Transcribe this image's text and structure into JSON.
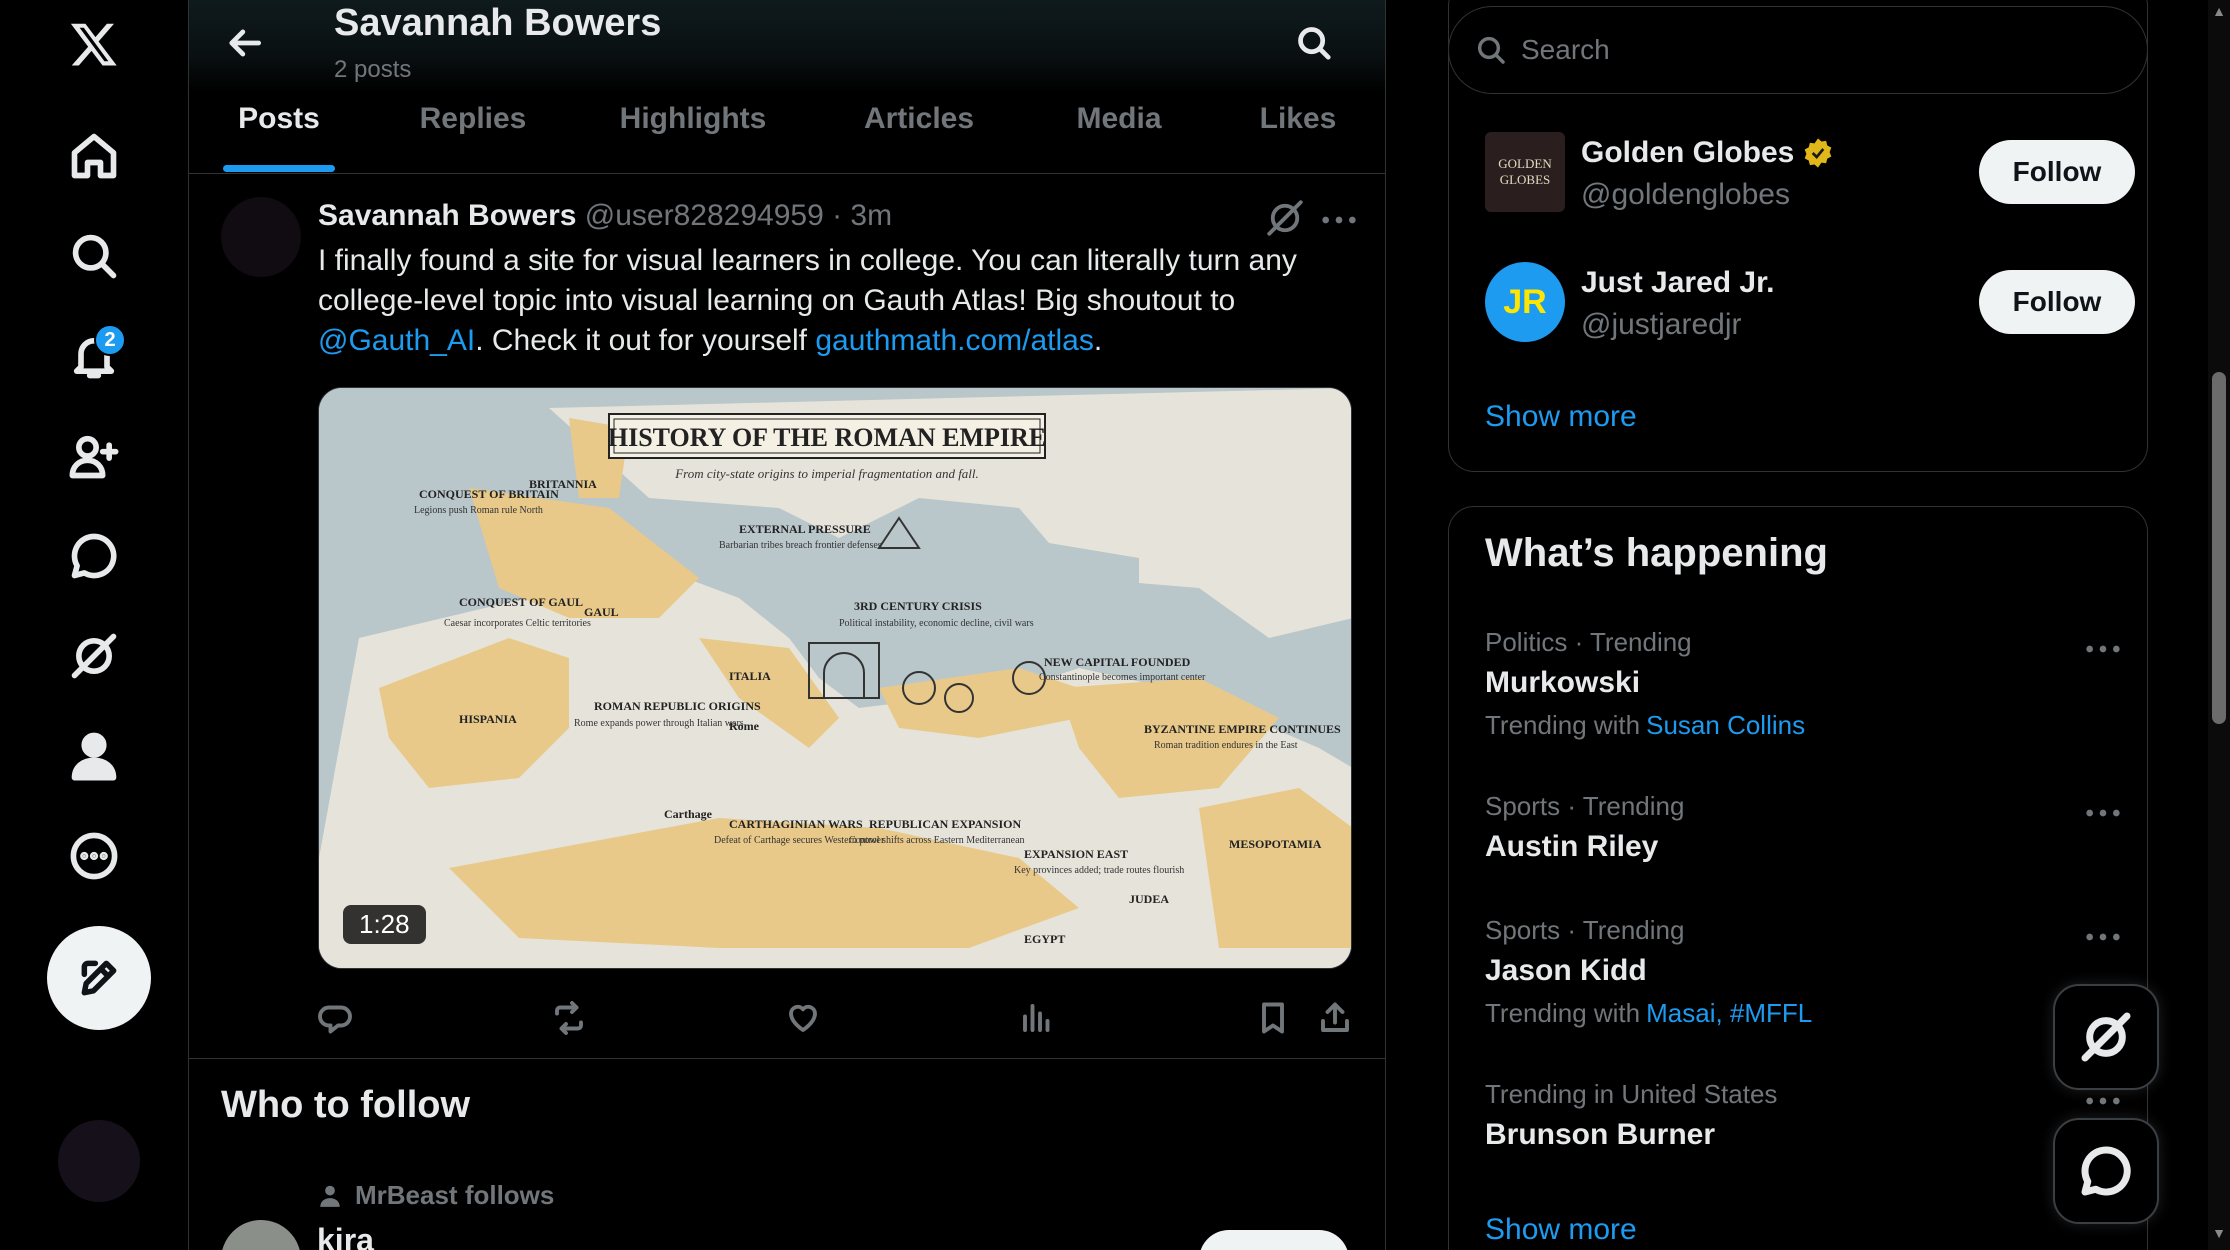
{
  "nav": {
    "notifications_badge": "2"
  },
  "header": {
    "title": "Savannah Bowers",
    "subtitle": "2 posts"
  },
  "tabs": [
    {
      "label": "Posts"
    },
    {
      "label": "Replies"
    },
    {
      "label": "Highlights"
    },
    {
      "label": "Articles"
    },
    {
      "label": "Media"
    },
    {
      "label": "Likes"
    }
  ],
  "post": {
    "name": "Savannah Bowers",
    "handle": "@user828294959",
    "time": "· 3m",
    "text_1": "I finally found a site for visual learners in college.  You can literally turn any college-level topic into visual learning on Gauth Atlas!  Big shoutout to ",
    "mention": "@Gauth_AI",
    "text_2": ". Check it out for yourself ",
    "url": "gauthmath.com/atlas",
    "text_3": ".",
    "video_duration": "1:28",
    "map": {
      "title": "HISTORY OF THE ROMAN EMPIRE",
      "subtitle": "From city-state origins to imperial fragmentation and fall.",
      "labels": {
        "britannia": "BRITANNIA",
        "conquest_britain": "CONQUEST OF BRITAIN",
        "conquest_britain_sub": "Legions push Roman rule North",
        "external_pressure": "EXTERNAL PRESSURE",
        "external_pressure_sub": "Barbarian tribes breach frontier defenses",
        "conquest_gaul": "CONQUEST OF GAUL",
        "conquest_gaul_sub": "Caesar incorporates Celtic territories",
        "gaul": "GAUL",
        "crisis": "3RD CENTURY CRISIS",
        "crisis_sub": "Political instability, economic decline, civil wars",
        "new_capital": "NEW CAPITAL FOUNDED",
        "new_capital_sub": "Constantinople becomes important center",
        "italia": "ITALIA",
        "hispania": "HISPANIA",
        "republic_origins": "ROMAN REPUBLIC ORIGINS",
        "republic_origins_sub": "Rome expands power through Italian wars",
        "rome": "Rome",
        "byzantine": "BYZANTINE EMPIRE CONTINUES",
        "byzantine_sub": "Roman tradition endures in the East",
        "carthage": "Carthage",
        "carthaginian_wars": "CARTHAGINIAN WARS",
        "carthaginian_wars_sub": "Defeat of Carthage secures Western power",
        "republican_expansion": "REPUBLICAN EXPANSION",
        "republican_expansion_sub": "Control shifts across Eastern Mediterranean",
        "expansion_east": "EXPANSION EAST",
        "expansion_east_sub": "Key provinces added; trade routes flourish",
        "mesopotamia": "MESOPOTAMIA",
        "judea": "JUDEA",
        "egypt": "EGYPT"
      }
    }
  },
  "who_to_follow": {
    "title": "Who to follow",
    "context": "MrBeast follows",
    "name": "kira"
  },
  "sidebar": {
    "search_placeholder": "Search",
    "accounts": [
      {
        "name": "Golden Globes",
        "handle": "@goldenglobes",
        "avatar_text": "GOLDEN GLOBES",
        "follow": "Follow"
      },
      {
        "name": "Just Jared Jr.",
        "handle": "@justjaredjr",
        "avatar_text": "JR",
        "follow": "Follow"
      }
    ],
    "show_more": "Show more",
    "whats_happening": "What’s happening",
    "trends": [
      {
        "context": "Politics · Trending",
        "title": "Murkowski",
        "with_label": "Trending with",
        "with": "Susan Collins"
      },
      {
        "context": "Sports · Trending",
        "title": "Austin Riley"
      },
      {
        "context": "Sports · Trending",
        "title": "Jason Kidd",
        "with_label": "Trending with",
        "with": "Masai, #MFFL"
      },
      {
        "context": "Trending in United States",
        "title": "Brunson Burner"
      }
    ],
    "show_more_trends": "Show more"
  },
  "colors": {
    "accent": "#1d9bf0",
    "background": "#000000",
    "border": "#2f3336",
    "muted": "#71767b"
  }
}
